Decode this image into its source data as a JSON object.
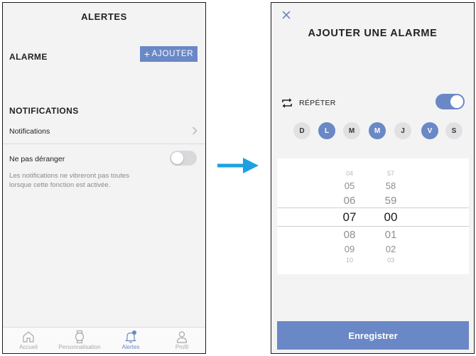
{
  "left_screen": {
    "title": "ALERTES",
    "alarm_section": {
      "label": "ALARME",
      "add_button": "AJOUTER"
    },
    "notifications_section": {
      "label": "NOTIFICATIONS",
      "notifications_row": "Notifications",
      "dnd_row": "Ne pas déranger",
      "dnd_enabled": false,
      "dnd_description": "Les notifications ne vibreront pas toutes lorsque cette fonction est activée."
    },
    "tabs": [
      {
        "label": "Accueil",
        "icon": "home-icon",
        "active": false
      },
      {
        "label": "Personnalisation",
        "icon": "watch-icon",
        "active": false
      },
      {
        "label": "Alertes",
        "icon": "bell-icon",
        "active": true
      },
      {
        "label": "Profil",
        "icon": "person-icon",
        "active": false
      }
    ]
  },
  "right_screen": {
    "title": "AJOUTER UNE ALARME",
    "close_icon": "close-icon",
    "repeat": {
      "label": "RÉPÉTER",
      "enabled": true,
      "icon": "repeat-icon"
    },
    "days": [
      {
        "label": "D",
        "selected": false
      },
      {
        "label": "L",
        "selected": true
      },
      {
        "label": "M",
        "selected": false
      },
      {
        "label": "M",
        "selected": true
      },
      {
        "label": "J",
        "selected": false
      },
      {
        "label": "V",
        "selected": true
      },
      {
        "label": "S",
        "selected": false
      }
    ],
    "time_picker": {
      "hours": [
        "04",
        "05",
        "06",
        "07",
        "08",
        "09",
        "10"
      ],
      "minutes": [
        "57",
        "58",
        "59",
        "00",
        "01",
        "02",
        "03"
      ],
      "selected_hour": "07",
      "selected_minute": "00"
    },
    "save_button": "Enregistrer"
  },
  "colors": {
    "accent": "#6a88c6",
    "transition_arrow": "#1ba1e2"
  }
}
